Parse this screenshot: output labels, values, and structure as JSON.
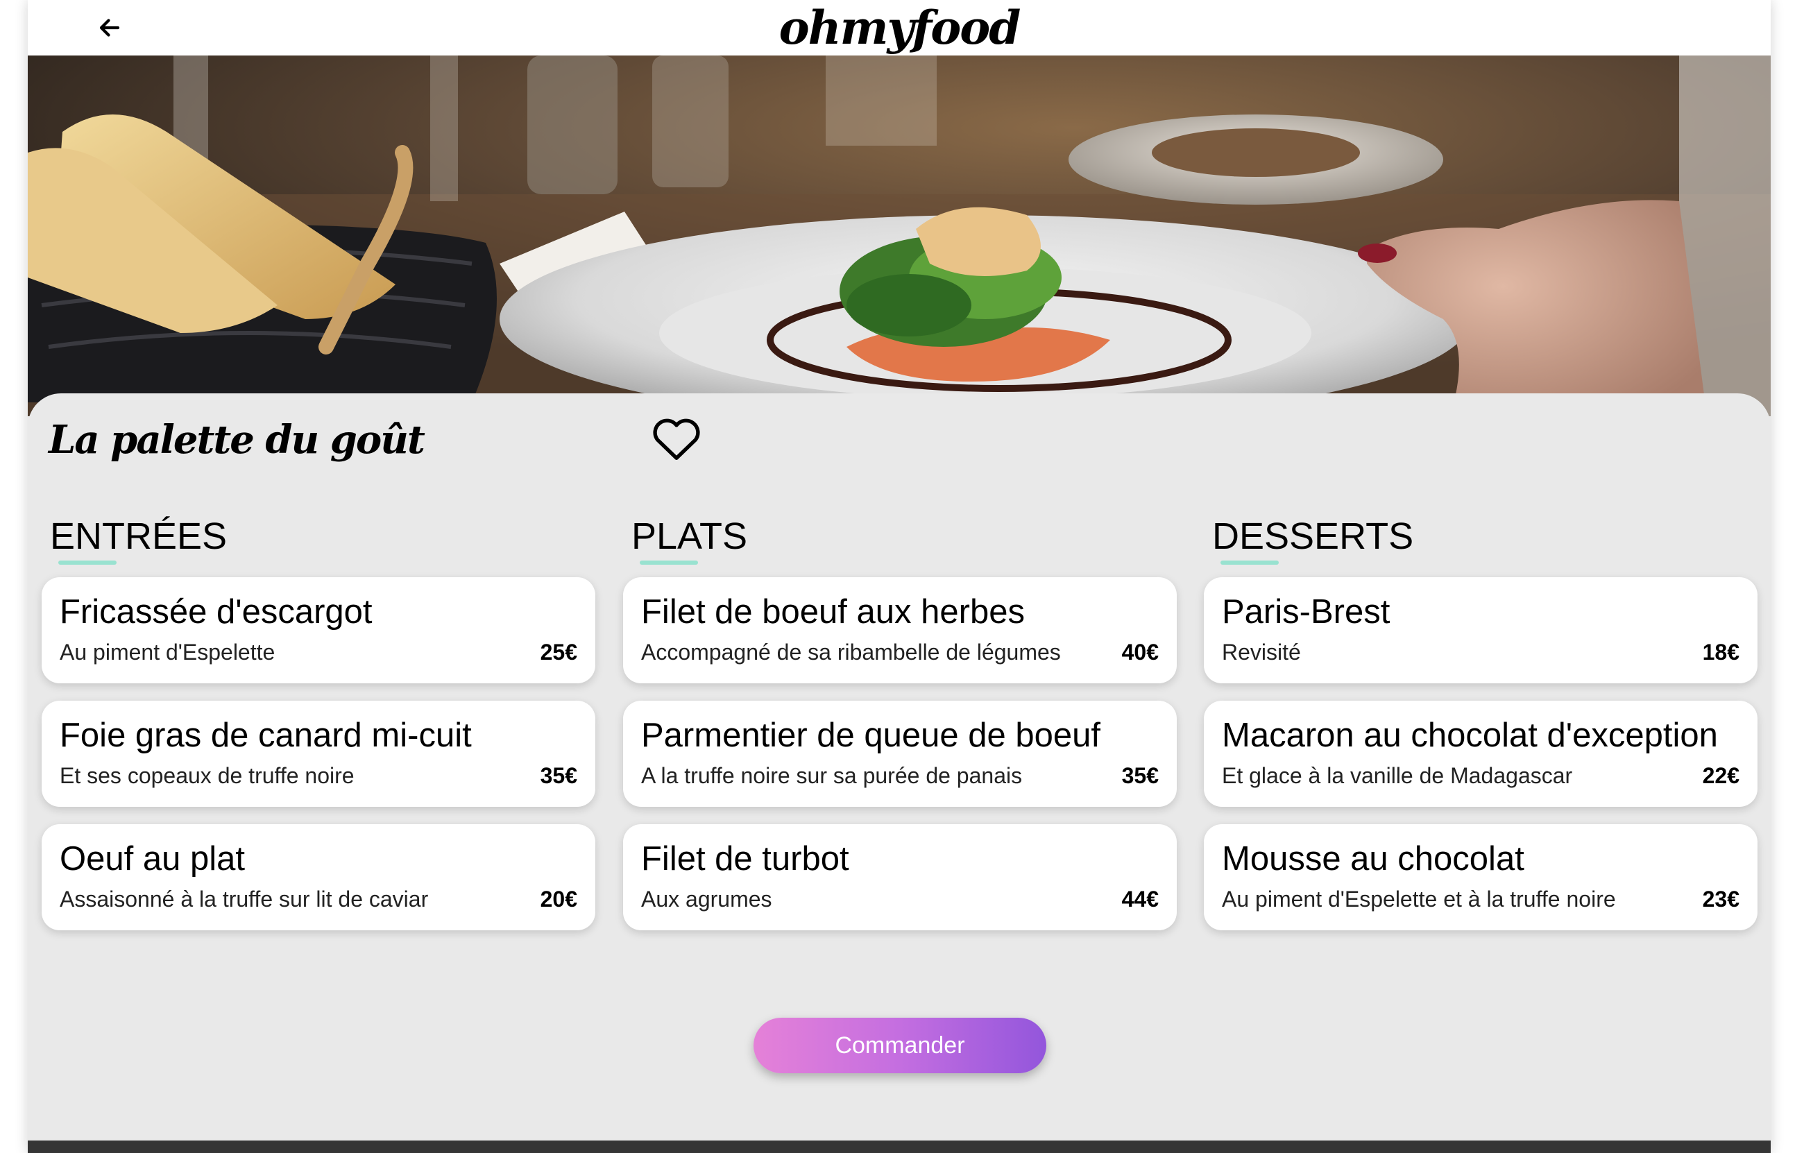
{
  "header": {
    "logo": "ohmyfood",
    "back_icon": "arrow-left-icon"
  },
  "restaurant": {
    "name": "La palette du goût",
    "favorite_icon": "heart-outline-icon"
  },
  "menu": {
    "entrees": {
      "title": "ENTRÉES",
      "dishes": [
        {
          "name": "Fricassée d'escargot",
          "desc": "Au piment d'Espelette",
          "price": "25€"
        },
        {
          "name": "Foie gras de canard mi-cuit",
          "desc": "Et ses copeaux de truffe noire",
          "price": "35€"
        },
        {
          "name": "Oeuf au plat",
          "desc": "Assaisonné à la truffe sur lit de caviar",
          "price": "20€"
        }
      ]
    },
    "plats": {
      "title": "PLATS",
      "dishes": [
        {
          "name": "Filet de boeuf aux herbes",
          "desc": "Accompagné de sa ribambelle de légumes",
          "price": "40€"
        },
        {
          "name": "Parmentier de queue de boeuf",
          "desc": "A la truffe noire sur sa purée de panais",
          "price": "35€"
        },
        {
          "name": "Filet de turbot",
          "desc": "Aux agrumes",
          "price": "44€"
        }
      ]
    },
    "desserts": {
      "title": "DESSERTS",
      "dishes": [
        {
          "name": "Paris-Brest",
          "desc": "Revisité",
          "price": "18€"
        },
        {
          "name": "Macaron au chocolat d'exception",
          "desc": "Et glace à la vanille de Madagascar",
          "price": "22€"
        },
        {
          "name": "Mousse au chocolat",
          "desc": "Au piment d'Espelette et à la truffe noire",
          "price": "23€"
        }
      ]
    }
  },
  "order_button": "Commander",
  "colors": {
    "accent_underline": "#99e2d0",
    "button_gradient_start": "#e581d8",
    "button_gradient_end": "#9356dc",
    "background": "#e9e9e9",
    "footer": "#353535"
  }
}
